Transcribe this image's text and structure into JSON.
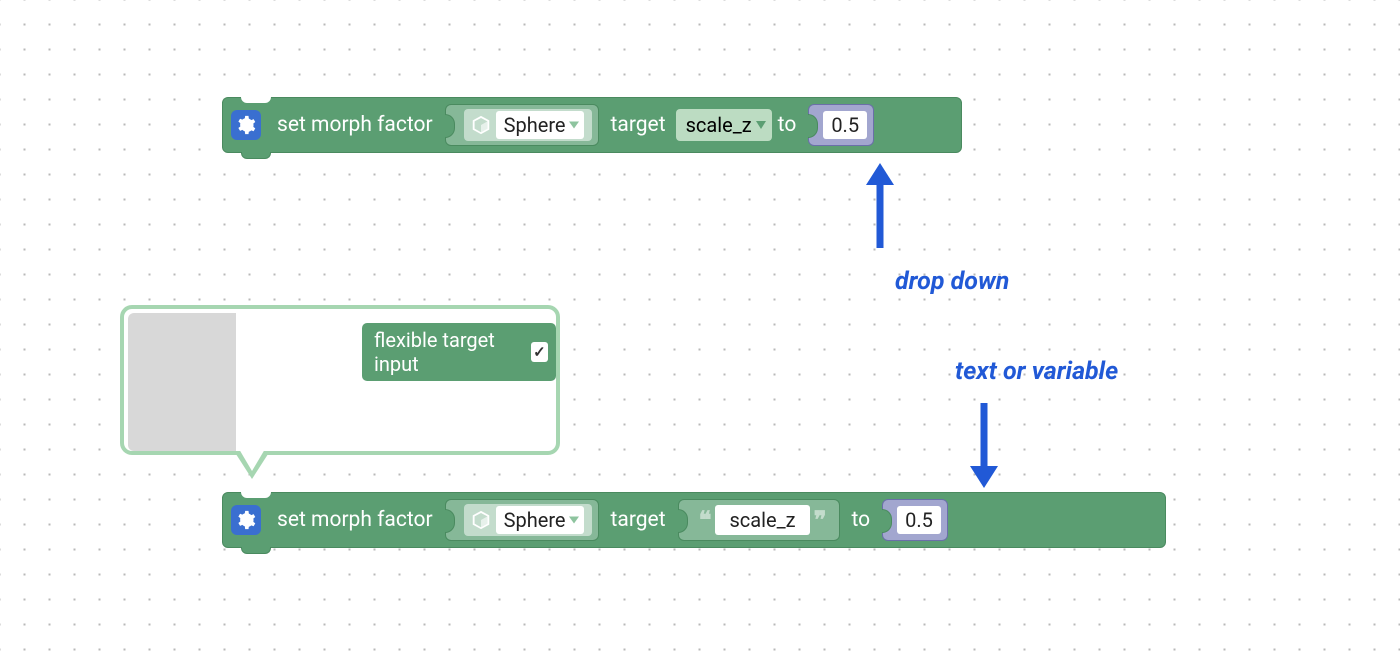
{
  "block1": {
    "action_label": "set morph factor",
    "object_value": "Sphere",
    "target_label": "target",
    "target_dropdown_value": "scale_z",
    "to_label": "to",
    "to_value": "0.5"
  },
  "comment": {
    "option_label": "flexible target input",
    "option_checked_glyph": "✓"
  },
  "block2": {
    "action_label": "set morph factor",
    "object_value": "Sphere",
    "target_label": "target",
    "target_text_value": "scale_z",
    "to_label": "to",
    "to_value": "0.5"
  },
  "annotations": {
    "dropdown_label": "drop down",
    "text_or_variable_label": "text or variable"
  },
  "icons": {
    "gear": "gear-icon",
    "cube": "cube-icon",
    "chevron_down": "chevron-down-icon",
    "open_quote": "❝",
    "close_quote": "❞"
  }
}
